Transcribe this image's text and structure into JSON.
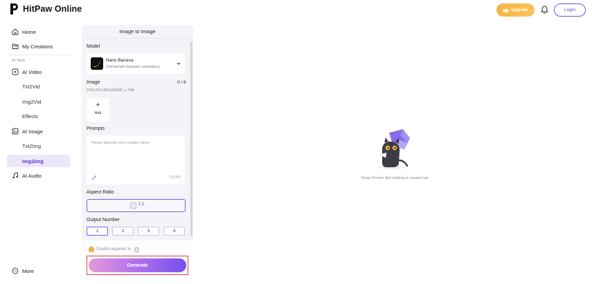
{
  "header": {
    "app_name": "HitPaw Online",
    "upgrade_label": "Upgrade",
    "login_label": "Login",
    "icons": [
      "logo-mark",
      "crown-icon",
      "bell-icon"
    ],
    "colors": {
      "accent": "#6f4fe7",
      "upgrade": "#f5b544"
    }
  },
  "sidebar": {
    "items": [
      {
        "label": "Home",
        "icon": "home-icon"
      },
      {
        "label": "My Creations",
        "icon": "folder-icon"
      }
    ],
    "section_label": "AI Tools",
    "ai_video": {
      "label": "AI Video",
      "icon": "video-icon",
      "children": [
        "Txt2Vid",
        "Img2Vid",
        "Effects"
      ]
    },
    "ai_image": {
      "label": "AI Image",
      "icon": "image-icon",
      "children": [
        "Txt2Img",
        "Img2Img"
      ]
    },
    "ai_audio": {
      "label": "AI Audio",
      "icon": "audio-icon"
    },
    "more": {
      "label": "More",
      "icon": "more-icon"
    },
    "active": "Img2Img"
  },
  "panel": {
    "title": "Image to Image",
    "model": {
      "section_label": "Model",
      "name": "Nano Banana",
      "description": "Unmatched character consistency"
    },
    "image": {
      "section_label": "Image",
      "count": "0 / 6",
      "hint": "PNG/JPG/JPEG/WEBP, ≤ 7MB",
      "add_label": "Add"
    },
    "prompts": {
      "section_label": "Prompts",
      "placeholder": "Please describe your creative ideas",
      "counter": "0/2000"
    },
    "aspect_ratio": {
      "section_label": "Aspect Ratio",
      "selected": "1:1"
    },
    "output_number": {
      "section_label": "Output Number",
      "options": [
        "1",
        "2",
        "3",
        "4"
      ],
      "selected": "1"
    },
    "credits_label": "Credits required: 4",
    "generate_label": "Generate"
  },
  "empty_state": {
    "message": "Oops! It looks like nothing is created yet"
  }
}
